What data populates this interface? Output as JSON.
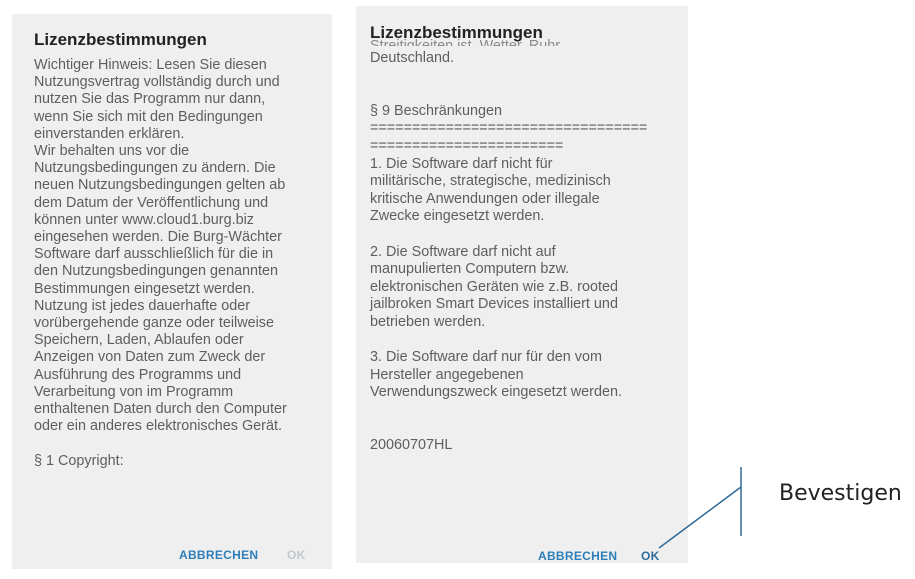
{
  "dialog_left": {
    "title": "Lizenzbestimmungen",
    "body": "Wichtiger Hinweis: Lesen Sie diesen\nNutzungsvertrag vollständig durch und\nnutzen Sie das Programm nur dann,\nwenn Sie sich mit den Bedingungen\neinverstanden erklären.\nWir behalten uns vor die\nNutzungsbedingungen zu ändern. Die\nneuen Nutzungsbedingungen gelten ab\ndem Datum der Veröffentlichung und\nkönnen unter www.cloud1.burg.biz\neingesehen werden.  Die Burg-Wächter\nSoftware darf ausschließlich für die in\nden Nutzungsbedingungen genannten\nBestimmungen eingesetzt werden.\nNutzung ist jedes dauerhafte oder\nvorübergehende ganze oder teilweise\nSpeichern, Laden, Ablaufen oder\nAnzeigen von Daten zum Zweck der\nAusführung des Programms und\nVerarbeitung von im Programm\nenthaltenen  Daten durch den Computer\noder ein anderes elektronisches Gerät.\n\n§ 1 Copyright:",
    "cancel_label": "ABBRECHEN",
    "ok_label": "OK"
  },
  "dialog_right": {
    "title": "Lizenzbestimmungen",
    "clipped_line": "Streitigkeiten ist, Wetter, Ruhr,",
    "body": "Deutschland.\n\n\n§ 9 Beschränkungen\n=================================\n=======================\n1. Die Software darf nicht für\nmilitärische, strategische, medizinisch\nkritische Anwendungen oder illegale\nZwecke eingesetzt werden.\n\n2. Die Software darf nicht auf\nmanupulierten Computern bzw.\nelektronischen Geräten wie z.B. rooted\njailbroken Smart Devices installiert und\nbetrieben werden.\n\n3. Die Software darf nur für den vom\nHersteller angegebenen\nVerwendungszweck eingesetzt werden.\n\n\n20060707HL",
    "cancel_label": "ABBRECHEN",
    "ok_label": "OK"
  },
  "annotation": {
    "label": "Bevestigen"
  }
}
